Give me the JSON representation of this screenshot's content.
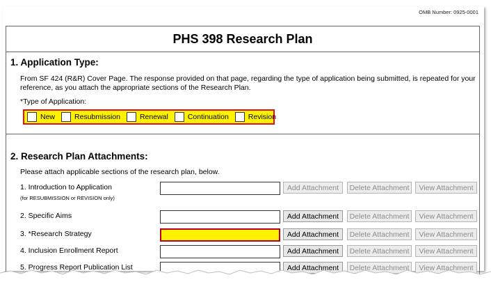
{
  "omb_number": "OMB Number: 0925-0001",
  "form_title": "PHS 398 Research Plan",
  "section1": {
    "heading": "1. Application Type:",
    "description": "From SF 424 (R&R) Cover Page. The response provided on that page, regarding the type of application being submitted, is repeated for your reference, as you attach the appropriate sections of the Research Plan.",
    "type_label": "*Type of Application:",
    "options": [
      "New",
      "Resubmission",
      "Renewal",
      "Continuation",
      "Revision"
    ]
  },
  "section2": {
    "heading": "2. Research Plan Attachments:",
    "description": "Please attach applicable sections of the research plan, below.",
    "buttons": {
      "add": "Add Attachment",
      "delete": "Delete Attachment",
      "view": "View Attachment"
    },
    "rows": [
      {
        "label": "1. Introduction to Application",
        "sublabel": "(for RESUBMISSION or REVISION only)",
        "add_enabled": false
      },
      {
        "label": "2. Specific Aims",
        "add_enabled": true
      },
      {
        "label": "3. *Research Strategy",
        "required": true,
        "add_enabled": true
      },
      {
        "label": "4. Inclusion Enrollment Report",
        "add_enabled": true
      },
      {
        "label": "5. Progress Report Publication List",
        "add_enabled": true
      }
    ]
  },
  "colors": {
    "highlight_yellow": "#fff200",
    "required_border": "#e01010"
  }
}
